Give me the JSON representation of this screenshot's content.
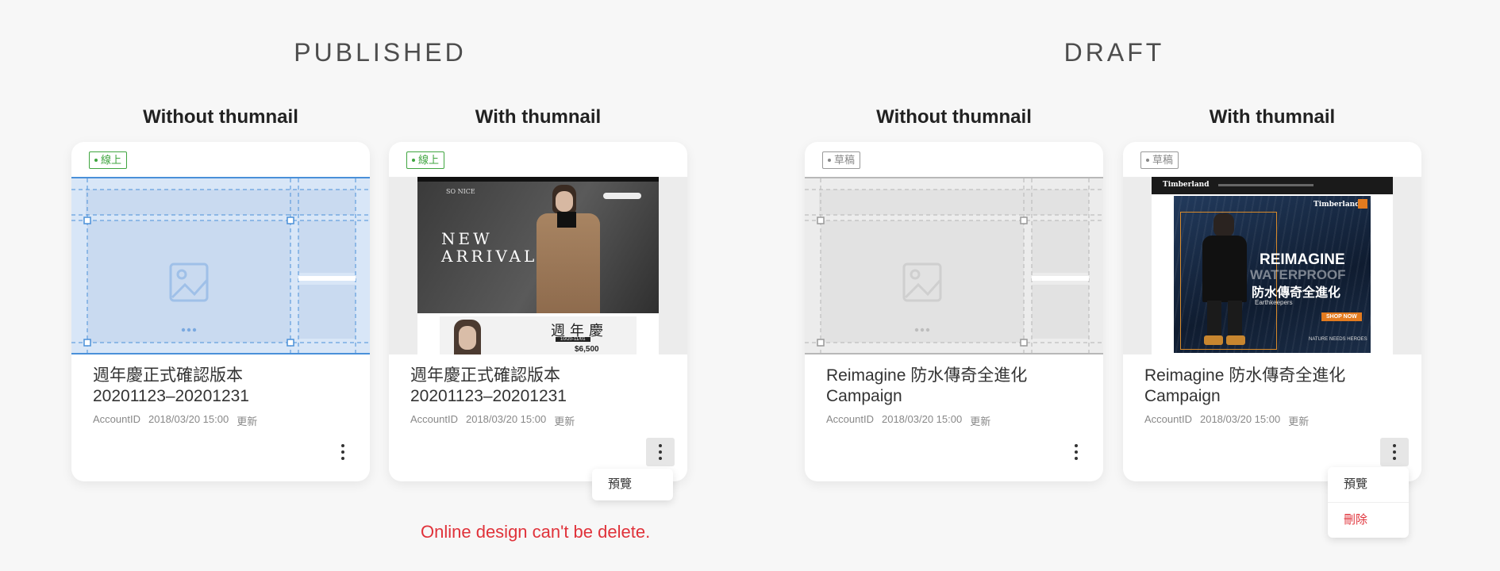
{
  "sections": {
    "published": "PUBLISHED",
    "draft": "DRAFT"
  },
  "columns": {
    "without": "Without thumnail",
    "with": "With thumnail"
  },
  "badges": {
    "online": "線上",
    "draft": "草稿"
  },
  "cards": [
    {
      "title_line1": "週年慶正式確認版本",
      "title_line2": "20201123–20201231",
      "account": "AccountID",
      "date": "2018/03/20 15:00",
      "status_word": "更新"
    },
    {
      "title_line1": "週年慶正式確認版本",
      "title_line2": "20201123–20201231",
      "account": "AccountID",
      "date": "2018/03/20 15:00",
      "status_word": "更新"
    },
    {
      "title_line1": "Reimagine 防水傳奇全進化",
      "title_line2": "Campaign",
      "account": "AccountID",
      "date": "2018/03/20 15:00",
      "status_word": "更新"
    },
    {
      "title_line1": "Reimagine 防水傳奇全進化",
      "title_line2": "Campaign",
      "account": "AccountID",
      "date": "2018/03/20 15:00",
      "status_word": "更新"
    }
  ],
  "menus": {
    "published": {
      "preview": "預覽"
    },
    "draft": {
      "preview": "預覽",
      "delete": "刪除"
    }
  },
  "thumb_text": {
    "brand1": "SO NICE",
    "headline1a": "NEW",
    "headline1b": "ARRIVAL",
    "promo1": "週年慶",
    "promo1_date": "10/20-11/01",
    "promo1_price": "$6,500",
    "brand2": "Timberland",
    "headline2a": "REIMAGINE",
    "headline2b": "WATERPROOF",
    "headline2c": "防水傳奇全進化",
    "sub2": "Earthkeepers",
    "shop2": "SHOP NOW",
    "tag2": "NATURE NEEDS HEROES"
  },
  "warning": "Online design can't be delete.",
  "colors": {
    "online_green": "#3fa53f",
    "danger_red": "#e0323a",
    "selection_blue": "#4a90d9"
  }
}
